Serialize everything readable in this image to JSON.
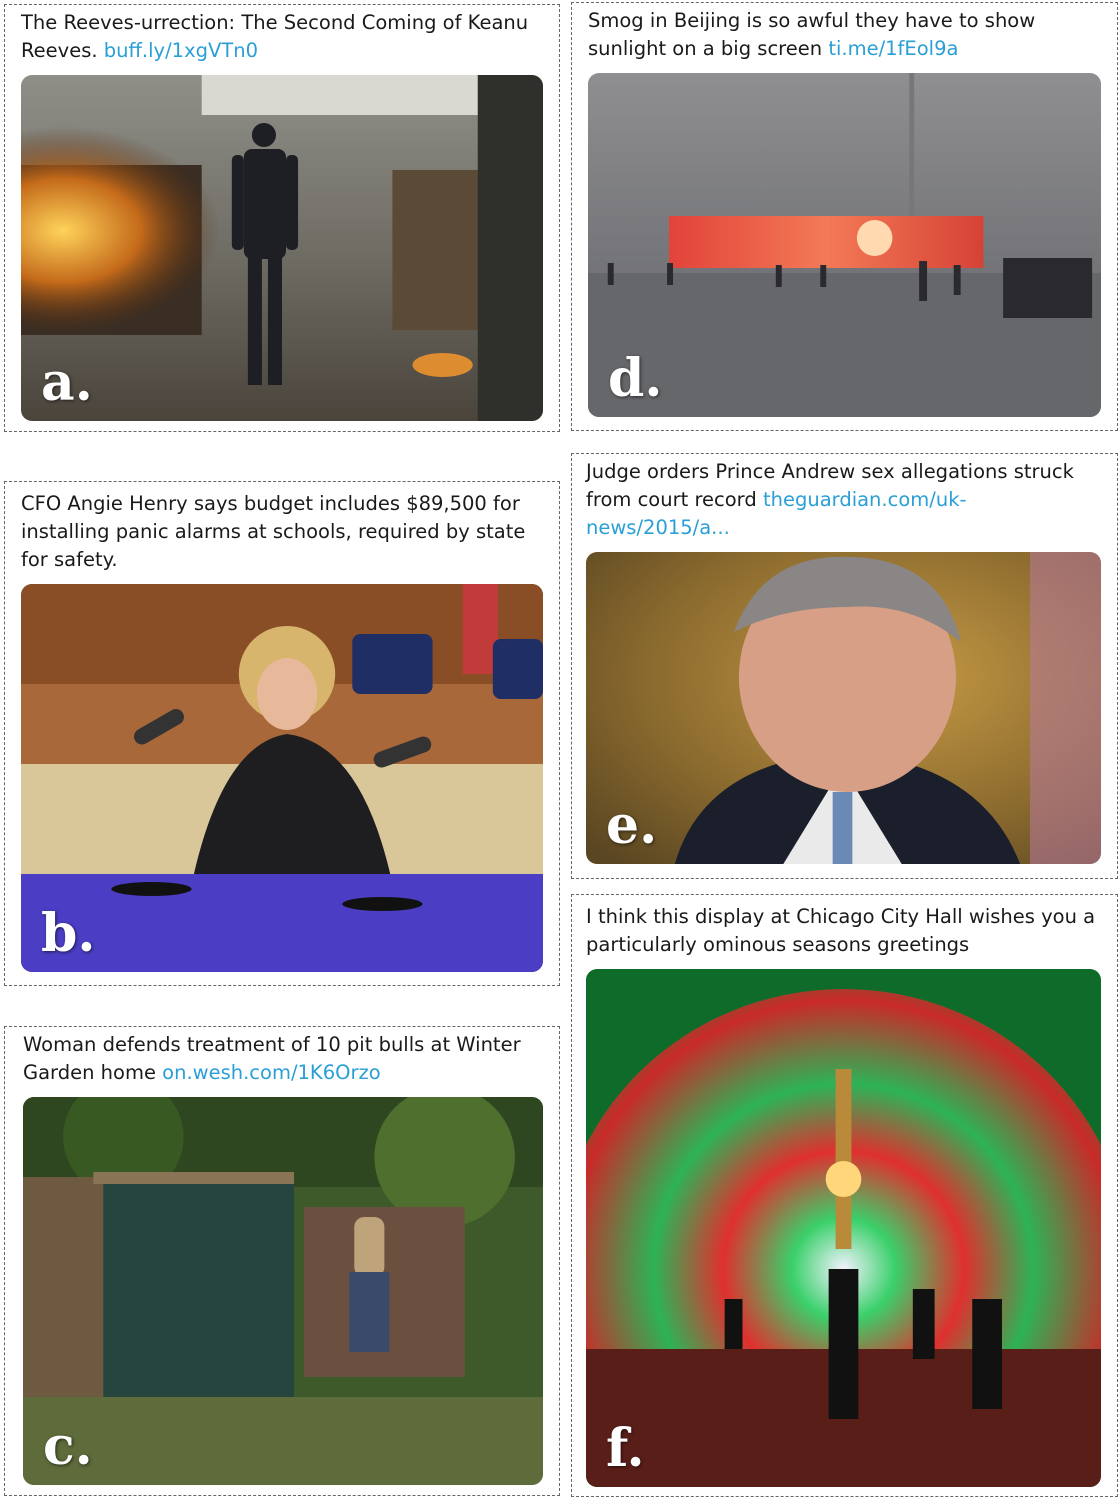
{
  "cards": [
    {
      "caption_text": "The Reeves-urrection: The Second Coming of Keanu Reeves.",
      "link": "buff.ly/1xgVTn0",
      "label": "a."
    },
    {
      "caption_text": "CFO Angie Henry says budget includes $89,500 for installing panic alarms at schools, required by state for safety.",
      "link": "",
      "label": "b."
    },
    {
      "caption_text": "Woman defends treatment of 10 pit bulls at Winter Garden home",
      "link": "on.wesh.com/1K6Orzo",
      "label": "c."
    },
    {
      "caption_text": "Smog in Beijing is so awful they have to show sunlight on a big screen",
      "link": "ti.me/1fEol9a",
      "label": "d."
    },
    {
      "caption_text": "Judge orders Prince Andrew sex allegations struck from court record",
      "link": "theguardian.com/uk-news/2015/a...",
      "label": "e."
    },
    {
      "caption_text": "I think this display at Chicago City Hall wishes you a particularly ominous seasons greetings",
      "link": "",
      "label": "f."
    }
  ],
  "colors": {
    "link": "#2a9fd6",
    "border": "#666666"
  }
}
